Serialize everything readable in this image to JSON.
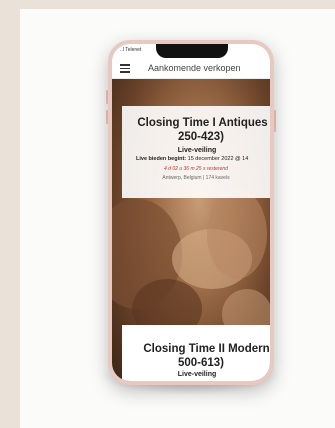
{
  "status_bar": {
    "carrier": "..l Telenet"
  },
  "header": {
    "title": "Aankomende verkopen"
  },
  "auctions": [
    {
      "title_line1": "Closing Time I Antiques (",
      "title_line2": "250-423)",
      "type": "Live-veiling",
      "start_label": "Live bieden begint:",
      "start_value": " 15 december 2022 @ 14",
      "countdown": "4 d 02 u 36 m 25 s resterend",
      "location": "Antwerp, Belgium | 174 kavels"
    },
    {
      "title_line1": "Closing Time II Modern (",
      "title_line2": "500-613)",
      "type": "Live-veiling"
    }
  ],
  "icons": {
    "menu": "hamburger-menu-icon"
  },
  "colors": {
    "background_band": "#eae2d8",
    "phone_frame": "#e7c9c2",
    "countdown": "#c0392b"
  }
}
